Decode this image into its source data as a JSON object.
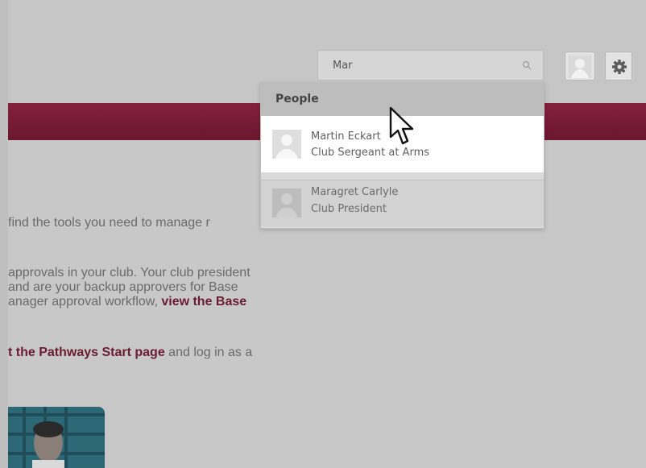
{
  "search": {
    "value": "Mar",
    "placeholder": ""
  },
  "dropdown": {
    "section_title": "People",
    "results": [
      {
        "name": "Martin Eckart",
        "role": "Club Sergeant at Arms"
      },
      {
        "name": "Maragret Carlyle",
        "role": "Club President"
      }
    ]
  },
  "body_text": {
    "line1": "find the tools you need to manage r",
    "line2": "approvals in your club. Your club president",
    "line3": "and are your backup approvers for Base",
    "line4_prefix": "anager approval workflow,",
    "line4_link": "view the Base",
    "line5_link": "t the Pathways Start page",
    "line5_suffix": "and log in as a"
  },
  "colors": {
    "maroon": "#7a1c36",
    "link": "#6a1b34"
  },
  "icons": {
    "search": "search-icon",
    "avatar": "user-avatar-icon",
    "settings": "gear-icon",
    "cursor": "mouse-pointer-icon"
  }
}
